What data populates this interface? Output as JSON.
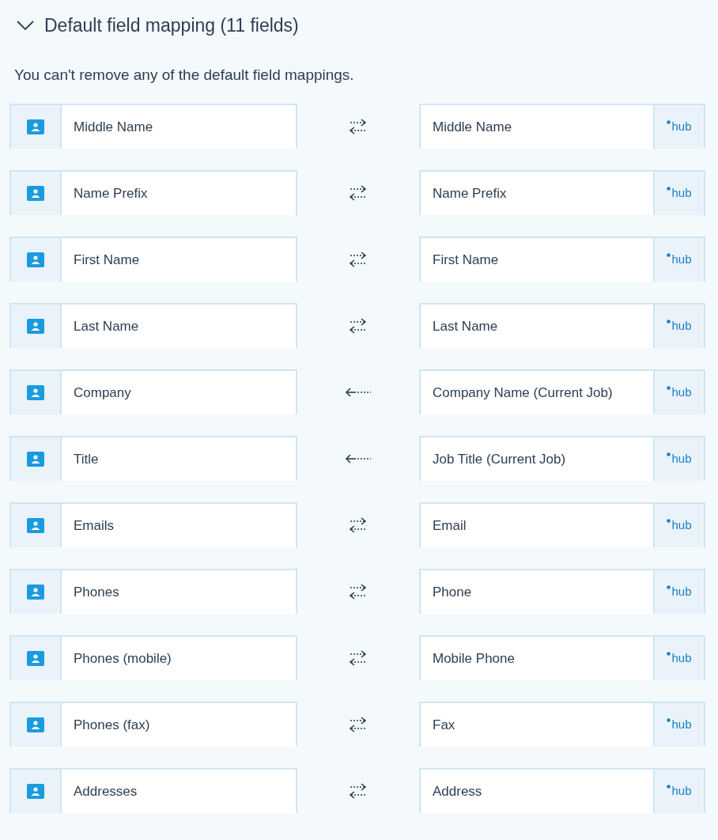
{
  "section": {
    "title": "Default field mapping (11 fields)",
    "expanded": true
  },
  "description": "You can't remove any of the default field mappings.",
  "mappings": [
    {
      "left": "Middle Name",
      "kind": "both",
      "right": "Middle Name",
      "logo": "hub"
    },
    {
      "left": "Name Prefix",
      "kind": "both",
      "right": "Name Prefix",
      "logo": "hub"
    },
    {
      "left": "First Name",
      "kind": "both",
      "right": "First Name",
      "logo": "hub"
    },
    {
      "left": "Last Name",
      "kind": "both",
      "right": "Last Name",
      "logo": "hub"
    },
    {
      "left": "Company",
      "kind": "left",
      "right": "Company Name (Current Job)",
      "logo": "hub"
    },
    {
      "left": "Title",
      "kind": "left",
      "right": "Job Title (Current Job)",
      "logo": "hub"
    },
    {
      "left": "Emails",
      "kind": "both",
      "right": "Email",
      "logo": "hub"
    },
    {
      "left": "Phones",
      "kind": "both",
      "right": "Phone",
      "logo": "hub"
    },
    {
      "left": "Phones (mobile)",
      "kind": "both",
      "right": "Mobile Phone",
      "logo": "hub"
    },
    {
      "left": "Phones (fax)",
      "kind": "both",
      "right": "Fax",
      "logo": "hub"
    },
    {
      "left": "Addresses",
      "kind": "both",
      "right": "Address",
      "logo": "hub"
    }
  ]
}
